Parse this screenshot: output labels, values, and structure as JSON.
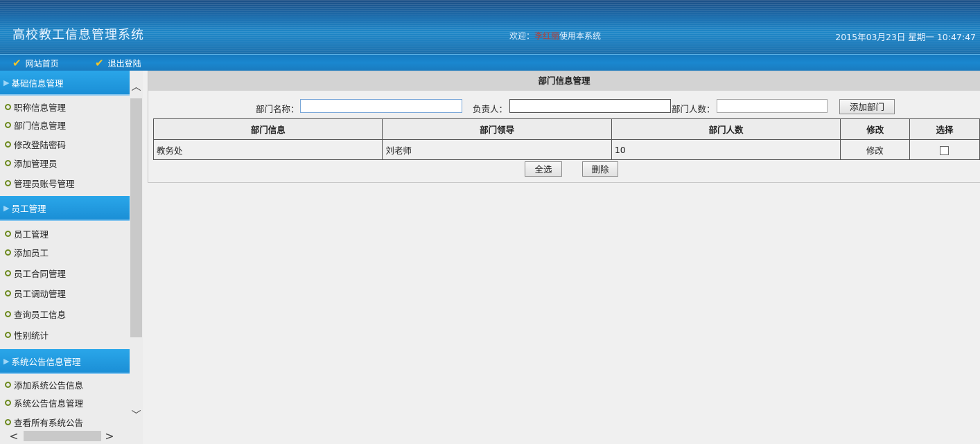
{
  "header": {
    "system_title": "高校教工信息管理系统",
    "welcome_prefix": "欢迎：",
    "user_name": "李红丽",
    "welcome_suffix": "使用本系统",
    "datetime": "2015年03月23日 星期一 10:47:47"
  },
  "nav": {
    "home": "网站首页",
    "logout": "退出登陆"
  },
  "sidebar": {
    "groups": [
      {
        "title": "基础信息管理",
        "items": [
          "职称信息管理",
          "部门信息管理",
          "修改登陆密码",
          "添加管理员",
          "管理员账号管理"
        ]
      },
      {
        "title": "员工管理",
        "items": [
          "员工管理",
          "添加员工",
          "员工合同管理",
          "员工调动管理",
          "查询员工信息",
          "性别统计"
        ]
      },
      {
        "title": "系统公告信息管理",
        "items": [
          "添加系统公告信息",
          "系统公告信息管理",
          "查看所有系统公告"
        ]
      }
    ]
  },
  "main": {
    "title": "部门信息管理",
    "form": {
      "dept_name_label": "部门名称：",
      "dept_name_value": "",
      "leader_label": "负责人：",
      "leader_value": "",
      "count_label": "部门人数：",
      "count_value": "",
      "add_button": "添加部门"
    },
    "table": {
      "headers": [
        "部门信息",
        "部门领导",
        "部门人数",
        "修改",
        "选择"
      ],
      "rows": [
        {
          "dept": "教务处",
          "leader": "刘老师",
          "count": "10",
          "edit": "修改",
          "selected": false
        }
      ]
    },
    "select_all_button": "全选",
    "delete_button": "删除"
  },
  "colors": {
    "header_blue": "#1a7bbf",
    "group_head": "#1b8fd6",
    "bullet_green": "#6d8a1e",
    "check_yellow": "#f3c52a",
    "user_red": "#c0392b"
  }
}
